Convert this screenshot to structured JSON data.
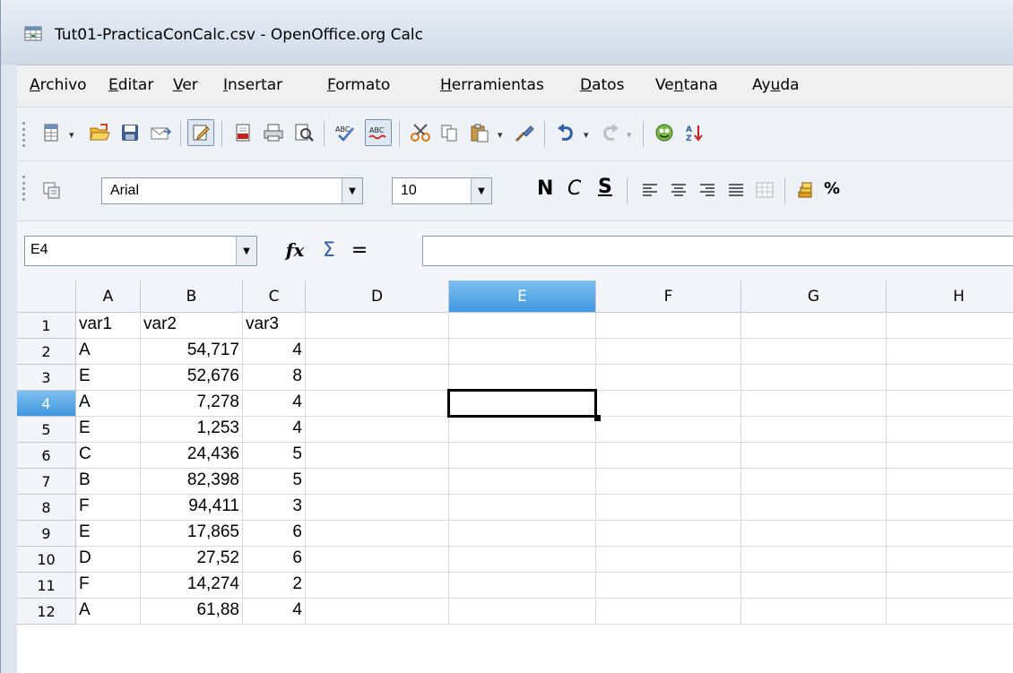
{
  "window": {
    "title": "Tut01-PracticaConCalc.csv - OpenOffice.org Calc",
    "app_icon": "calc-spreadsheet-icon"
  },
  "menu": [
    {
      "label": "Archivo",
      "u": "A",
      "rest": "rchivo"
    },
    {
      "label": "Editar",
      "u": "E",
      "rest": "ditar"
    },
    {
      "label": "Ver",
      "u": "V",
      "rest": "er"
    },
    {
      "label": "Insertar",
      "u": "I",
      "rest": "nsertar"
    },
    {
      "label": "Formato",
      "u": "F",
      "rest": "ormato"
    },
    {
      "label": "Herramientas",
      "u": "H",
      "rest": "erramientas"
    },
    {
      "label": "Datos",
      "u": "D",
      "rest": "atos"
    },
    {
      "label": "Ventana",
      "pre": "Ve",
      "u": "n",
      "rest": "tana"
    },
    {
      "label": "Ayuda",
      "pre": "Ay",
      "u": "u",
      "rest": "da"
    }
  ],
  "toolbar_standard": {
    "icons": [
      "new-document-icon",
      "open-folder-icon",
      "save-icon",
      "email-icon",
      "edit-file-icon",
      "export-pdf-icon",
      "print-icon",
      "page-preview-icon",
      "spellcheck-icon",
      "autospellcheck-icon",
      "cut-icon",
      "copy-icon",
      "paste-icon",
      "clone-format-icon",
      "undo-icon",
      "redo-icon",
      "navigator-icon",
      "sort-ascending-icon"
    ]
  },
  "toolbar_formatting": {
    "font_name": "Arial",
    "font_size": "10",
    "bold_label": "N",
    "italic_label": "C",
    "underline_label": "S",
    "currency_label": "%"
  },
  "formula_bar": {
    "name_box": "E4",
    "fx_label": "fx",
    "sum_label": "Σ",
    "equals_label": "=",
    "formula": ""
  },
  "sheet": {
    "columns": [
      "A",
      "B",
      "C",
      "D",
      "E",
      "F",
      "G",
      "H"
    ],
    "selected_column": "E",
    "selected_row": "4",
    "rows": [
      {
        "n": "1",
        "a": "var1",
        "b": "var2",
        "c": "var3"
      },
      {
        "n": "2",
        "a": "A",
        "b": "54,717",
        "c": "4"
      },
      {
        "n": "3",
        "a": "E",
        "b": "52,676",
        "c": "8"
      },
      {
        "n": "4",
        "a": "A",
        "b": "7,278",
        "c": "4"
      },
      {
        "n": "5",
        "a": "E",
        "b": "1,253",
        "c": "4"
      },
      {
        "n": "6",
        "a": "C",
        "b": "24,436",
        "c": "5"
      },
      {
        "n": "7",
        "a": "B",
        "b": "82,398",
        "c": "5"
      },
      {
        "n": "8",
        "a": "F",
        "b": "94,411",
        "c": "3"
      },
      {
        "n": "9",
        "a": "E",
        "b": "17,865",
        "c": "6"
      },
      {
        "n": "10",
        "a": "D",
        "b": "27,52",
        "c": "6"
      },
      {
        "n": "11",
        "a": "F",
        "b": "14,274",
        "c": "2"
      },
      {
        "n": "12",
        "a": "A",
        "b": "61,88",
        "c": "4"
      }
    ]
  }
}
